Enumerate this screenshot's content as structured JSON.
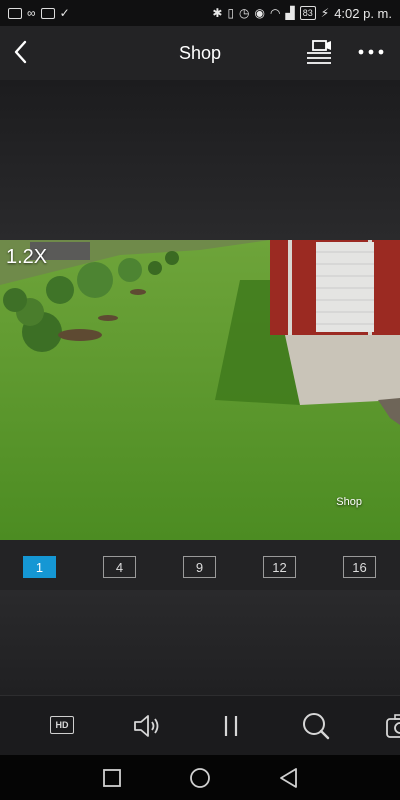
{
  "status_bar": {
    "time": "4:02 p. m.",
    "battery": "83",
    "left_icons": [
      "mail-icon",
      "voicemail-icon",
      "gmail-icon",
      "download-done-icon"
    ],
    "right_icons": [
      "bluetooth-icon",
      "vibrate-icon",
      "alarm-icon",
      "eye-icon",
      "wifi-icon",
      "signal-icon",
      "battery-icon",
      "charging-icon"
    ]
  },
  "header": {
    "title": "Shop",
    "back_icon": "back-chevron-icon",
    "playback_icon": "playback-list-icon",
    "more_icon": "more-dots-icon"
  },
  "video": {
    "zoom": "1.2X",
    "camera_label": "Shop"
  },
  "split_views": {
    "options": [
      "1",
      "4",
      "9",
      "12",
      "16"
    ],
    "selected": "1",
    "accent_color": "#1597d4"
  },
  "toolbar": {
    "hd_label": "HD",
    "tools": [
      "hd-quality-icon",
      "speaker-icon",
      "pause-icon",
      "digital-zoom-icon",
      "snapshot-camera-icon"
    ]
  },
  "nav": {
    "buttons": [
      "recent-apps-icon",
      "home-icon",
      "back-triangle-icon"
    ]
  }
}
